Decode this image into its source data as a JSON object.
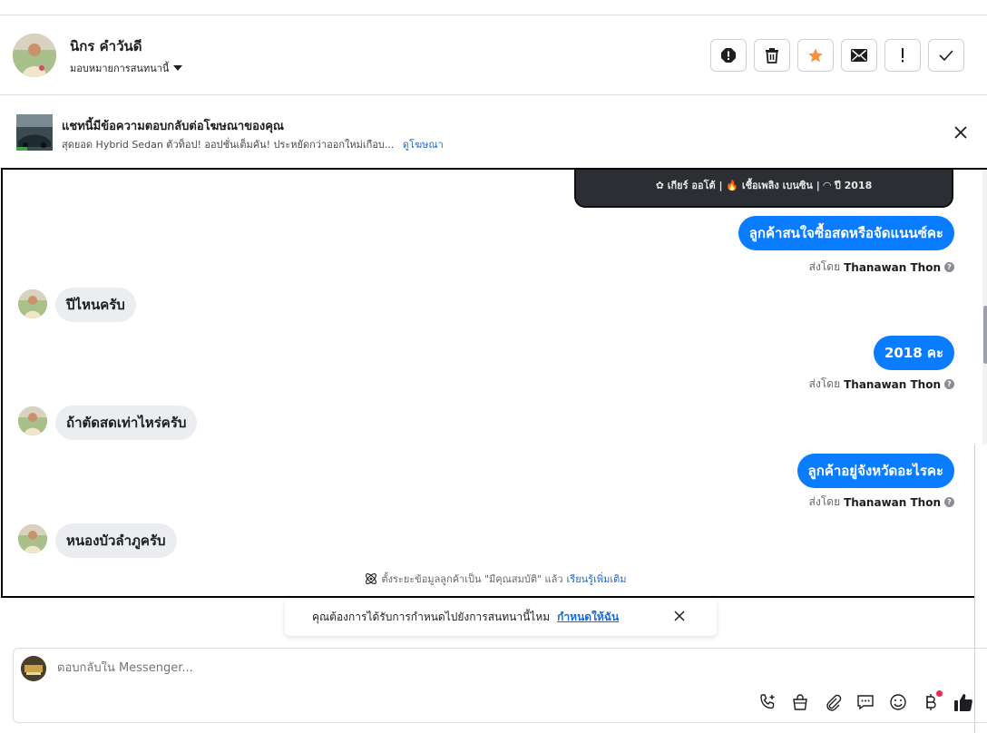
{
  "header": {
    "contact_name": "นิกร คำวันดี",
    "assign_label": "มอบหมายการสนทนานี้"
  },
  "ad_banner": {
    "title": "แชทนี้มีข้อความตอบกลับต่อโฆษณาของคุณ",
    "description": "สุดยอด Hybrid Sedan ตัวท็อป! ออปชั่นเต็มคัน! ประหยัดกว่าออกใหม่เกือบ...",
    "link": "ดูโฆษณา"
  },
  "ad_card": {
    "specs": "✿ เกียร์ ออโต้   |  🔥 เชื้อเพลิง เบนซิน   |  ◠ ปี 2018"
  },
  "messages": [
    {
      "direction": "out",
      "text": "ลูกค้าสนใจซื้อสดหรือจัดแนนซ์คะ",
      "sent_by_prefix": "ส่งโดย",
      "sent_by_name": "Thanawan Thon"
    },
    {
      "direction": "in",
      "text": "ปีไหนครับ"
    },
    {
      "direction": "out",
      "text": "2018 คะ",
      "sent_by_prefix": "ส่งโดย",
      "sent_by_name": "Thanawan Thon"
    },
    {
      "direction": "in",
      "text": "ถ้าตัดสดเท่าไหร่ครับ"
    },
    {
      "direction": "out",
      "text": "ลูกค้าอยู่จังหวัดอะไรคะ",
      "sent_by_prefix": "ส่งโดย",
      "sent_by_name": "Thanawan Thon"
    },
    {
      "direction": "in",
      "text": "หนองบัวลำภูครับ"
    }
  ],
  "notice": {
    "text": "ตั้งระยะข้อมูลลูกค้าเป็น \"มีคุณสมบัติ\" แล้ว",
    "learn_more": "เรียนรู้เพิ่มเติม"
  },
  "assign_toast": {
    "text": "คุณต้องการได้รับการกำหนดไปยังการสนทนานี้ไหม",
    "action": "กำหนดให้ฉัน"
  },
  "composer": {
    "placeholder": "ตอบกลับใน Messenger..."
  },
  "colors": {
    "accent": "#0a7cff",
    "link": "#1d6ad6",
    "star": "#f7923b",
    "incoming_bubble": "#ebedf0"
  },
  "icons": {
    "header_actions": [
      "spam-icon",
      "trash-icon",
      "star-icon",
      "mail-icon",
      "exclamation-icon",
      "check-icon"
    ],
    "composer_tools": [
      "call-add-icon",
      "shopping-bag-icon",
      "paperclip-icon",
      "chat-bubble-icon",
      "emoji-icon",
      "baht-icon",
      "thumbs-up-icon"
    ]
  }
}
